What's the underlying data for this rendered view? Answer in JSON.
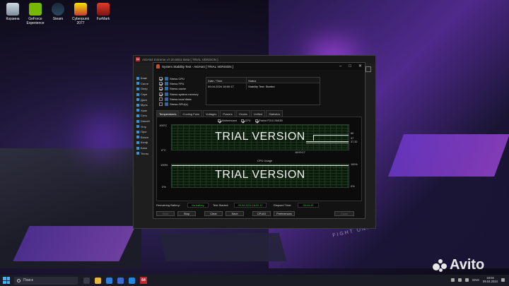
{
  "desktop": {
    "icons": [
      {
        "label": "Корзина",
        "icon": "recycle-bin-icon"
      },
      {
        "label": "GeForce Experience",
        "icon": "geforce-icon"
      },
      {
        "label": "Steam",
        "icon": "steam-icon"
      },
      {
        "label": "Cyberpunk 2077",
        "icon": "cyberpunk-icon"
      },
      {
        "label": "FurMark",
        "icon": "furmark-icon"
      }
    ],
    "wallpaper_text": "FIGHT ON."
  },
  "aida_main": {
    "title": "AIDA64 Extreme v7.20.6811 Beta [ TRIAL VERSION ]",
    "logo": "64",
    "sidebar": [
      "Комп",
      "Систе",
      "Опер",
      "Серв",
      "Дисп",
      "Муль",
      "Хран",
      "Сеть",
      "DirectX",
      "Устр",
      "Прог",
      "Безоп",
      "Конф",
      "База",
      "Тесты"
    ]
  },
  "dialog": {
    "title": "System Stability Test - AIDA64 [ TRIAL VERSION ]",
    "stress": [
      {
        "label": "Stress CPU",
        "checked": true
      },
      {
        "label": "Stress FPU",
        "checked": true
      },
      {
        "label": "Stress cache",
        "checked": true
      },
      {
        "label": "Stress system memory",
        "checked": true
      },
      {
        "label": "Stress local disks",
        "checked": false
      },
      {
        "label": "Stress GPU(s)",
        "checked": false
      }
    ],
    "status_table": {
      "headers": [
        "Date / Time",
        "Status"
      ],
      "rows": [
        [
          "09.04.2024 18:00:17",
          "Stability Test: Started"
        ]
      ]
    },
    "tabs": [
      "Temperatures",
      "Cooling Fans",
      "Voltages",
      "Powers",
      "Clocks",
      "Unified",
      "Statistics"
    ],
    "active_tab": "Temperatures",
    "legend": [
      {
        "label": "Motherboard",
        "checked": true
      },
      {
        "label": "CPU",
        "checked": true
      },
      {
        "label": "Patriot P210 256GB",
        "checked": true
      }
    ],
    "temp_graph": {
      "watermark": "TRIAL VERSION",
      "y_top": "100°C",
      "y_bottom": "0°C",
      "time": "18:00:17",
      "right_values": [
        "60",
        "37",
        "37,32"
      ]
    },
    "usage_graph": {
      "title": "CPU Usage",
      "watermark": "TRIAL VERSION",
      "y_top": "100%",
      "y_bottom": "0%",
      "right_top": "100%",
      "right_bottom": "0%"
    },
    "info": {
      "battery_label": "Remaining Battery:",
      "battery_value": "No battery",
      "started_label": "Test Started:",
      "started_value": "09.04.2024 18:00:17",
      "elapsed_label": "Elapsed Time:",
      "elapsed_value": "00:04:42"
    },
    "buttons": {
      "start": "Start",
      "stop": "Stop",
      "clear": "Clear",
      "save": "Save",
      "cpuid": "CPUID",
      "preferences": "Preferences",
      "close": "Close"
    }
  },
  "taskbar": {
    "search_placeholder": "Поиск",
    "aida_label": "64",
    "lang": "ENG",
    "time": "18:04",
    "date": "09.04.2024"
  },
  "watermark": {
    "text": "Avito"
  }
}
